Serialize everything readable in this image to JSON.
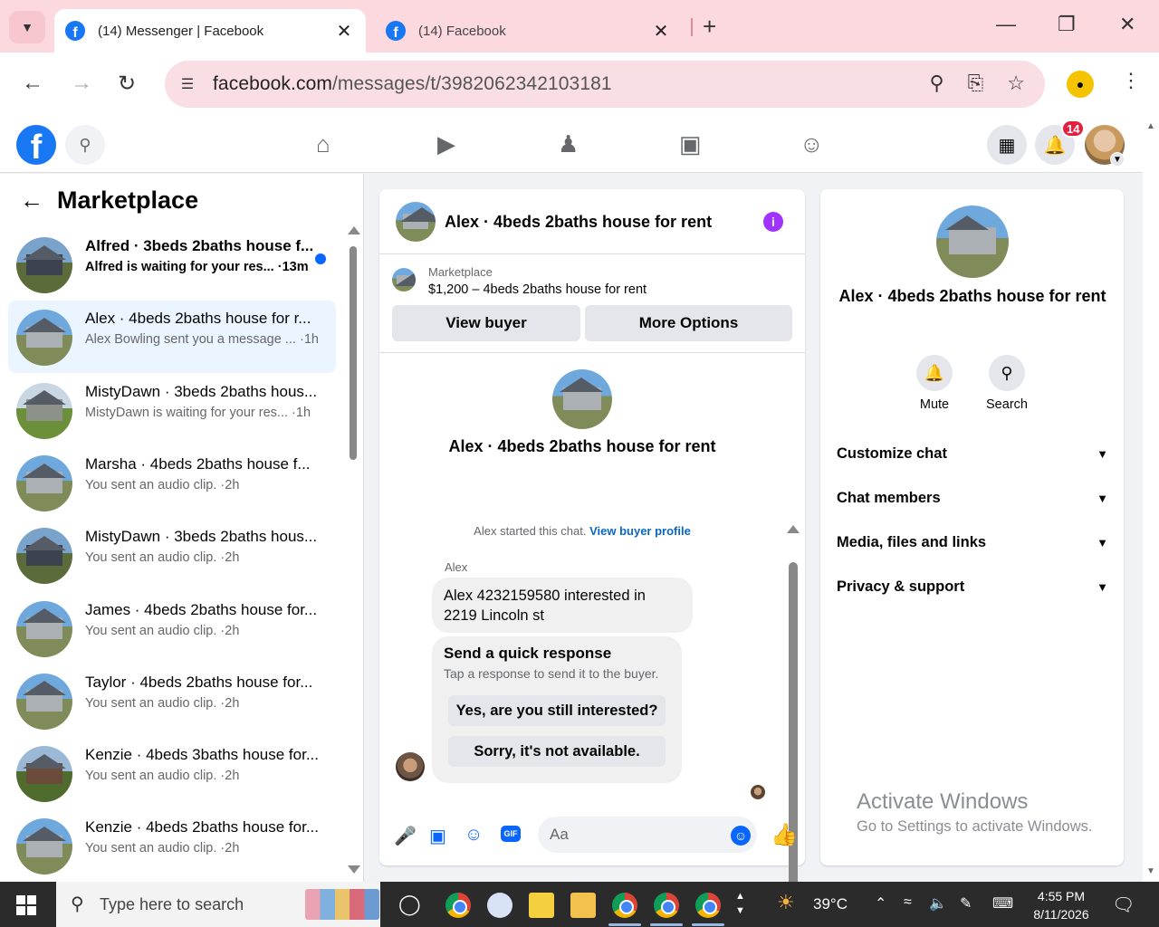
{
  "browser": {
    "tabs": [
      {
        "title": "(14) Messenger | Facebook",
        "active": true
      },
      {
        "title": "(14) Facebook",
        "active": false
      }
    ],
    "url_domain": "facebook.com",
    "url_path": "/messages/t/3982062342103181"
  },
  "fb_header": {
    "notification_count": "14",
    "nav_icons": [
      "home-icon",
      "video-icon",
      "friends-icon",
      "marketplace-icon",
      "groups-icon"
    ]
  },
  "left": {
    "title": "Marketplace",
    "conversations": [
      {
        "name": "Alfred · 3beds 2baths house f...",
        "sub": "Alfred is waiting for your res...",
        "time": "13m",
        "unread": true,
        "selected": false,
        "thumb": "dark"
      },
      {
        "name": "Alex · 4beds 2baths house for r...",
        "sub": "Alex Bowling sent you a message ...",
        "time": "1h",
        "unread": false,
        "selected": true,
        "thumb": "plain"
      },
      {
        "name": "MistyDawn · 3beds 2baths hous...",
        "sub": "MistyDawn is waiting for your res...",
        "time": "1h",
        "unread": false,
        "selected": false,
        "thumb": "green"
      },
      {
        "name": "Marsha · 4beds 2baths house f...",
        "sub": "You sent an audio clip.",
        "time": "2h",
        "unread": false,
        "selected": false,
        "thumb": "plain"
      },
      {
        "name": "MistyDawn · 3beds 2baths hous...",
        "sub": "You sent an audio clip.",
        "time": "2h",
        "unread": false,
        "selected": false,
        "thumb": "dark"
      },
      {
        "name": "James · 4beds 2baths house for...",
        "sub": "You sent an audio clip.",
        "time": "2h",
        "unread": false,
        "selected": false,
        "thumb": "plain"
      },
      {
        "name": "Taylor · 4beds 2baths house for...",
        "sub": "You sent an audio clip.",
        "time": "2h",
        "unread": false,
        "selected": false,
        "thumb": "plain"
      },
      {
        "name": "Kenzie · 4beds 3baths house for...",
        "sub": "You sent an audio clip.",
        "time": "2h",
        "unread": false,
        "selected": false,
        "thumb": "brick"
      },
      {
        "name": "Kenzie · 4beds 2baths house for...",
        "sub": "You sent an audio clip.",
        "time": "2h",
        "unread": false,
        "selected": false,
        "thumb": "plain"
      }
    ]
  },
  "chat": {
    "title": "Alex · 4beds 2baths house for rent",
    "marketplace_label": "Marketplace",
    "listing": "$1,200 – 4beds 2baths house for rent",
    "view_buyer": "View buyer",
    "more_options": "More Options",
    "intro_title": "Alex · 4beds 2baths house for rent",
    "started_text": "Alex started this chat.",
    "view_profile": "View buyer profile",
    "sender": "Alex",
    "message": "Alex 4232159580 interested in 2219 Lincoln st",
    "quick_title": "Send a quick response",
    "quick_sub": "Tap a response to send it to the buyer.",
    "quick_replies": [
      "Yes, are you still interested?",
      "Sorry, it's not available."
    ],
    "input_placeholder": "Aa",
    "gif_label": "GIF"
  },
  "info": {
    "title": "Alex · 4beds 2baths house for rent",
    "actions": [
      {
        "label": "Mute",
        "icon": "bell-icon"
      },
      {
        "label": "Search",
        "icon": "search-icon"
      }
    ],
    "sections": [
      "Customize chat",
      "Chat members",
      "Media, files and links",
      "Privacy & support"
    ],
    "activate_title": "Activate Windows",
    "activate_sub": "Go to Settings to activate Windows."
  },
  "taskbar": {
    "search_placeholder": "Type here to search",
    "weather": "39°C",
    "time": "4:55 PM",
    "date": "8/11/2026"
  }
}
